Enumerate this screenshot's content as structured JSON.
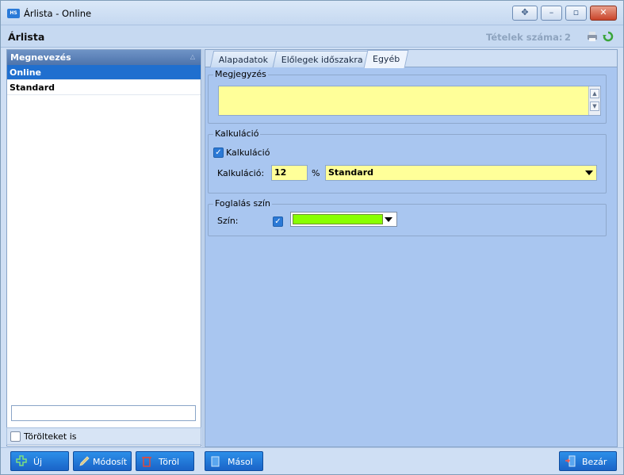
{
  "window": {
    "title": "Árlista - Online",
    "app_icon_text": "HS"
  },
  "header": {
    "title": "Árlista",
    "count_label": "Tételek száma:",
    "count_value": "2"
  },
  "list": {
    "column_header": "Megnevezés",
    "items": [
      {
        "label": "Online",
        "selected": true
      },
      {
        "label": "Standard",
        "selected": false
      }
    ],
    "search_value": "",
    "show_deleted_label": "Törölteket is",
    "show_deleted_checked": false
  },
  "tabs": [
    {
      "label": "Alapadatok",
      "active": false
    },
    {
      "label": "Előlegek időszakra",
      "active": false
    },
    {
      "label": "Egyéb",
      "active": true
    }
  ],
  "note_group": {
    "title": "Megjegyzés",
    "value": ""
  },
  "calc_group": {
    "title": "Kalkuláció",
    "checkbox_label": "Kalkuláció",
    "checkbox_checked": true,
    "field_label": "Kalkuláció:",
    "percent_value": "12",
    "percent_sign": "%",
    "type_value": "Standard"
  },
  "booking_group": {
    "title": "Foglalás szín",
    "color_label": "Szín:",
    "color_checked": true,
    "color_value": "#88ff00"
  },
  "buttons": {
    "new": "Új",
    "edit": "Módosít",
    "delete": "Töröl",
    "copy": "Másol",
    "close": "Bezár"
  },
  "colors": {
    "accent": "#1f6fcf",
    "input_bg": "#ffff99",
    "panel_bg": "#a9c6f0"
  }
}
